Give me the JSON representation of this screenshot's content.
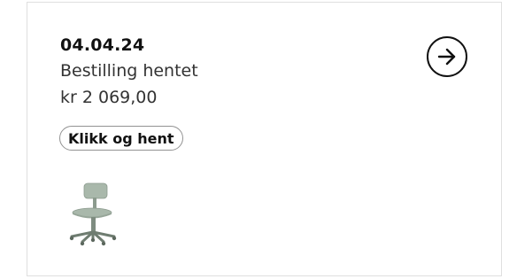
{
  "order": {
    "date": "04.04.24",
    "status": "Bestilling hentet",
    "price": "kr 2 069,00",
    "badge": "Klikk og hent"
  },
  "icons": {
    "open": "arrow-right-circle-icon",
    "product": "office-chair-thumbnail"
  },
  "colors": {
    "border": "#dfdfdf",
    "text": "#111111",
    "chair": "#a9b8ab"
  }
}
